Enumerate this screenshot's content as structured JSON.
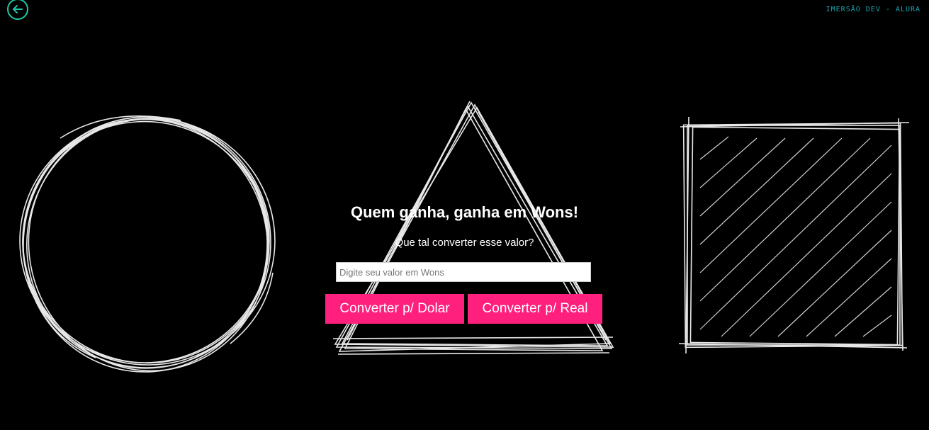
{
  "header": {
    "back_icon": "arrow-left-icon",
    "brand_text": "IMERSÃO DEV - ALURA"
  },
  "main": {
    "title": "Quem ganha, ganha em Wons!",
    "subtitle": "Que tal converter esse valor?",
    "input_placeholder": "Digite seu valor em Wons",
    "input_value": "",
    "button_dolar": "Converter p/ Dolar",
    "button_real": "Converter p/ Real"
  },
  "decor": {
    "shapes": [
      "circle-sketch",
      "triangle-sketch",
      "square-sketch"
    ]
  },
  "colors": {
    "background": "#000000",
    "accent_teal": "#1fc7a8",
    "brand_text": "#1aa6b0",
    "button_pink": "#ff1f7d",
    "text": "#ffffff"
  }
}
